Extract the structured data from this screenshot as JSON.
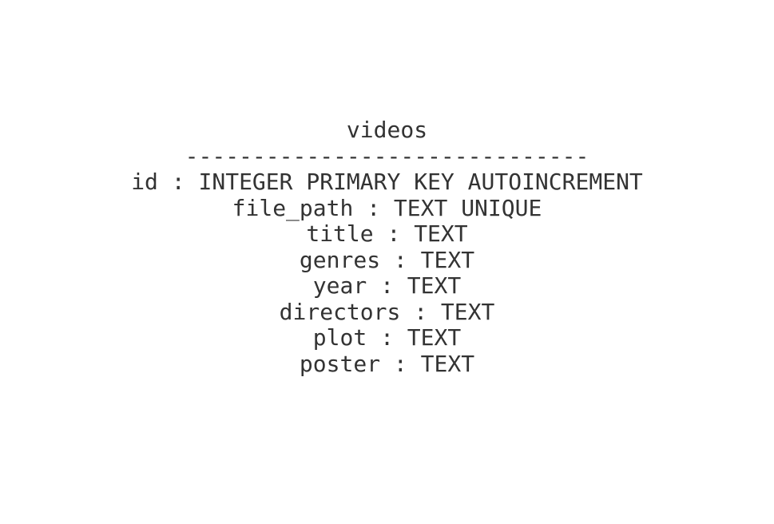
{
  "table": {
    "name": "videos",
    "divider": "------------------------------",
    "fields": [
      "id : INTEGER PRIMARY KEY AUTOINCREMENT",
      "file_path : TEXT UNIQUE",
      "title : TEXT",
      "genres : TEXT",
      "year : TEXT",
      "directors : TEXT",
      "plot : TEXT",
      "poster : TEXT"
    ]
  },
  "colors": {
    "text": "#333333",
    "background": "#ffffff"
  }
}
